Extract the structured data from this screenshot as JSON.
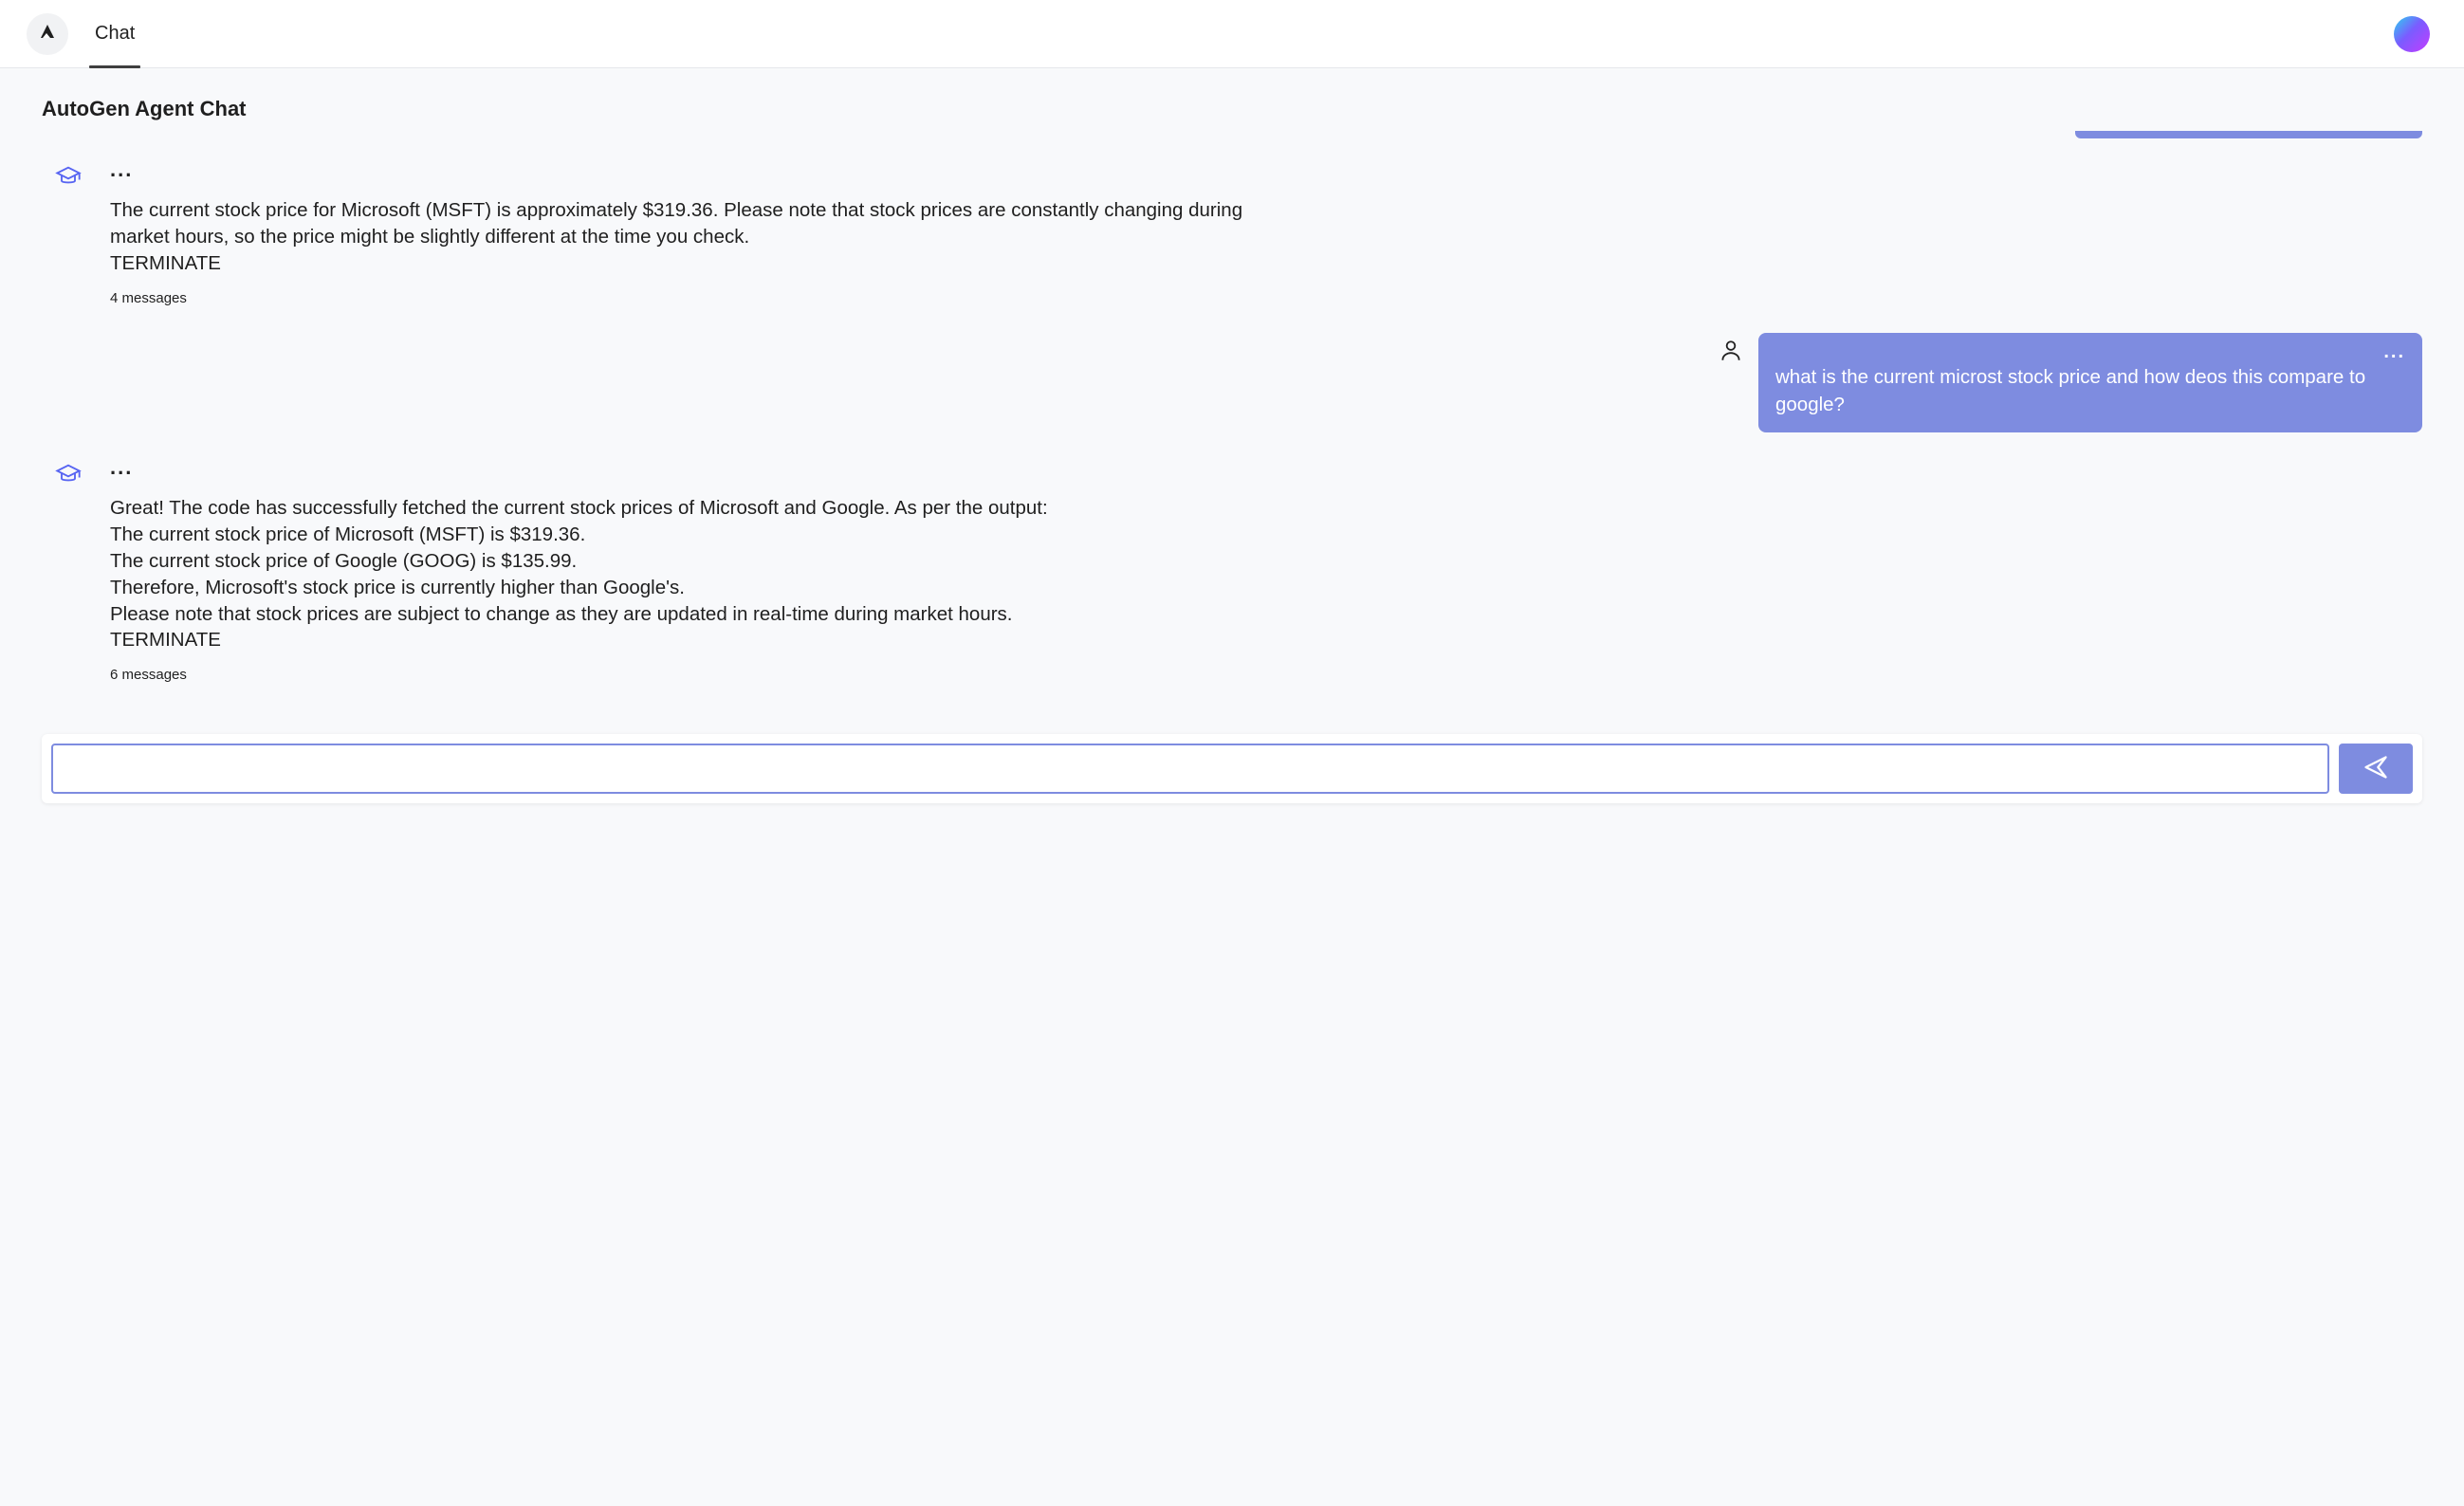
{
  "header": {
    "tab_label": "Chat"
  },
  "page": {
    "title": "AutoGen Agent Chat"
  },
  "messages": {
    "agent1": {
      "text": "The current stock price for Microsoft (MSFT) is approximately $319.36. Please note that stock prices are constantly changing during market hours, so the price might be slightly different at the time you check.\nTERMINATE",
      "meta": "4 messages",
      "ellipsis": "..."
    },
    "user1": {
      "text": "what is the current microst stock price and how deos this compare to google?",
      "ellipsis": "..."
    },
    "agent2": {
      "text": "Great! The code has successfully fetched the current stock prices of Microsoft and Google. As per the output:\nThe current stock price of Microsoft (MSFT) is $319.36.\nThe current stock price of Google (GOOG) is $135.99.\nTherefore, Microsoft's stock price is currently higher than Google's.\nPlease note that stock prices are subject to change as they are updated in real-time during market hours.\nTERMINATE",
      "meta": "6 messages",
      "ellipsis": "..."
    }
  },
  "composer": {
    "placeholder": ""
  },
  "colors": {
    "accent": "#7e8ce0"
  }
}
